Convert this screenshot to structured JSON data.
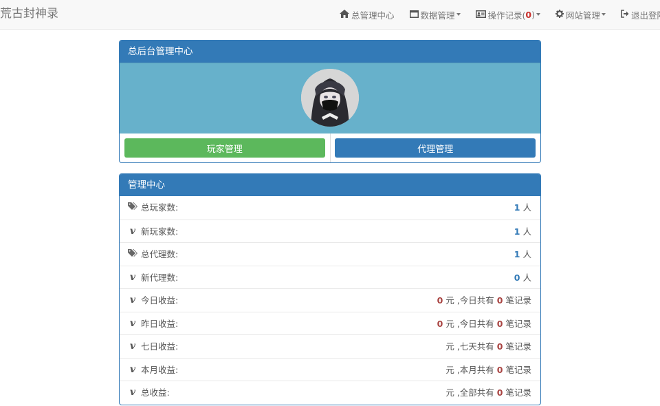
{
  "brand": "荒古封神录",
  "nav": [
    {
      "icon": "home-icon",
      "label": "总管理中心"
    },
    {
      "icon": "window-icon",
      "label": "数据管理"
    },
    {
      "icon": "id-card-icon",
      "label_pre": "操作记录(",
      "count": "0",
      "label_post": ")"
    },
    {
      "icon": "gear-icon",
      "label": "网站管理"
    },
    {
      "icon": "logout-icon",
      "label": "退出登陆"
    }
  ],
  "admin_panel": {
    "title": "总后台管理中心",
    "players_button": "玩家管理",
    "agents_button": "代理管理"
  },
  "stats_panel": {
    "title": "管理中心",
    "rows": [
      {
        "icon": "tags-icon",
        "label": "总玩家数:",
        "value": "1",
        "unit": "人"
      },
      {
        "icon": "vimeo-icon",
        "label": "新玩家数:",
        "value": "1",
        "unit": "人"
      },
      {
        "icon": "tags-icon",
        "label": "总代理数:",
        "value": "1",
        "unit": "人"
      },
      {
        "icon": "vimeo-icon",
        "label": "新代理数:",
        "value": "0",
        "unit": "人"
      },
      {
        "icon": "vimeo-icon",
        "label": "今日收益:",
        "amount": "0",
        "text_mid": "元 ,今日共有",
        "records": "0",
        "text_end": "笔记录"
      },
      {
        "icon": "vimeo-icon",
        "label": "昨日收益:",
        "amount": "0",
        "text_mid": "元 ,今日共有",
        "records": "0",
        "text_end": "笔记录"
      },
      {
        "icon": "vimeo-icon",
        "label": "七日收益:",
        "amount": "",
        "text_mid": "元 ,七天共有",
        "records": "0",
        "text_end": "笔记录"
      },
      {
        "icon": "vimeo-icon",
        "label": "本月收益:",
        "amount": "",
        "text_mid": "元 ,本月共有",
        "records": "0",
        "text_end": "笔记录"
      },
      {
        "icon": "vimeo-icon",
        "label": "总收益:",
        "amount": "",
        "text_mid": "元 ,全部共有",
        "records": "0",
        "text_end": "笔记录"
      }
    ]
  }
}
